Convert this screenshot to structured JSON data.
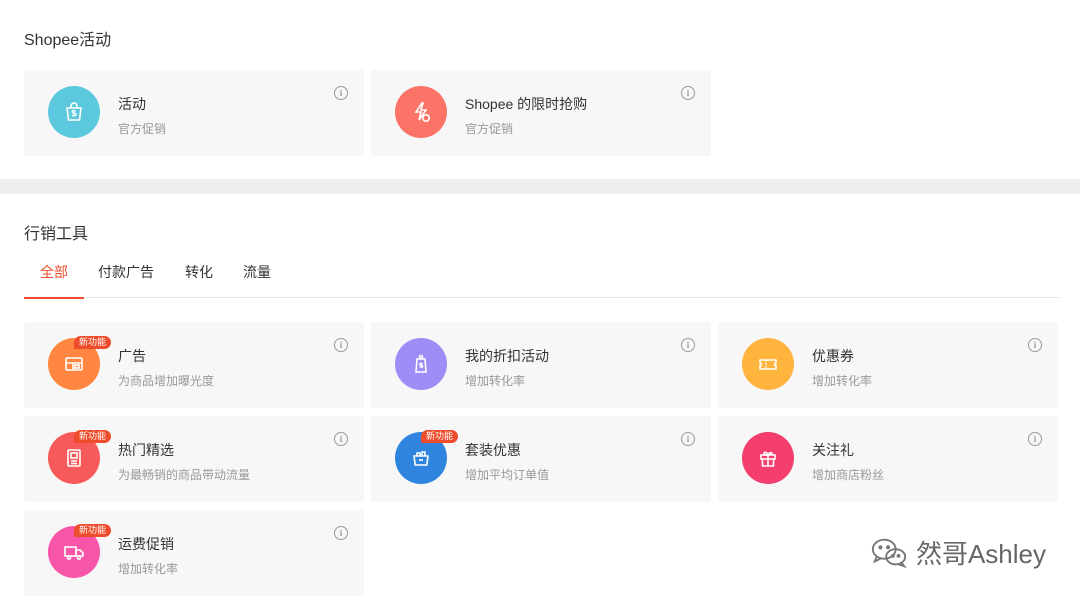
{
  "activity_section": {
    "title": "Shopee活动",
    "cards": [
      {
        "name": "活动",
        "desc": "官方促销",
        "icon": "shopping-bag-icon",
        "color": "#5bc8dd"
      },
      {
        "name": "Shopee 的限时抢购",
        "desc": "官方促销",
        "icon": "flash-sale-icon",
        "color": "#fb7467"
      }
    ]
  },
  "marketing_section": {
    "title": "行销工具",
    "tabs": [
      "全部",
      "付款广告",
      "转化",
      "流量"
    ],
    "active_tab": "全部",
    "badge_text": "新功能",
    "cards": [
      {
        "name": "广告",
        "desc": "为商品增加曝光度",
        "icon": "ads-icon",
        "color": "#ff8540",
        "badge": true
      },
      {
        "name": "我的折扣活动",
        "desc": "增加转化率",
        "icon": "discount-tag-icon",
        "color": "#9d8df7",
        "badge": false
      },
      {
        "name": "优惠券",
        "desc": "增加转化率",
        "icon": "voucher-icon",
        "color": "#ffb43d",
        "badge": false
      },
      {
        "name": "热门精选",
        "desc": "为最畅销的商品带动流量",
        "icon": "top-picks-icon",
        "color": "#f75a5a",
        "badge": true
      },
      {
        "name": "套装优惠",
        "desc": "增加平均订单值",
        "icon": "bundle-icon",
        "color": "#2f84e0",
        "badge": true
      },
      {
        "name": "关注礼",
        "desc": "增加商店粉丝",
        "icon": "gift-icon",
        "color": "#f43f6e",
        "badge": false
      },
      {
        "name": "运费促销",
        "desc": "增加转化率",
        "icon": "shipping-truck-icon",
        "color": "#f755a7",
        "badge": true
      }
    ]
  },
  "watermark": {
    "text": "然哥Ashley"
  }
}
